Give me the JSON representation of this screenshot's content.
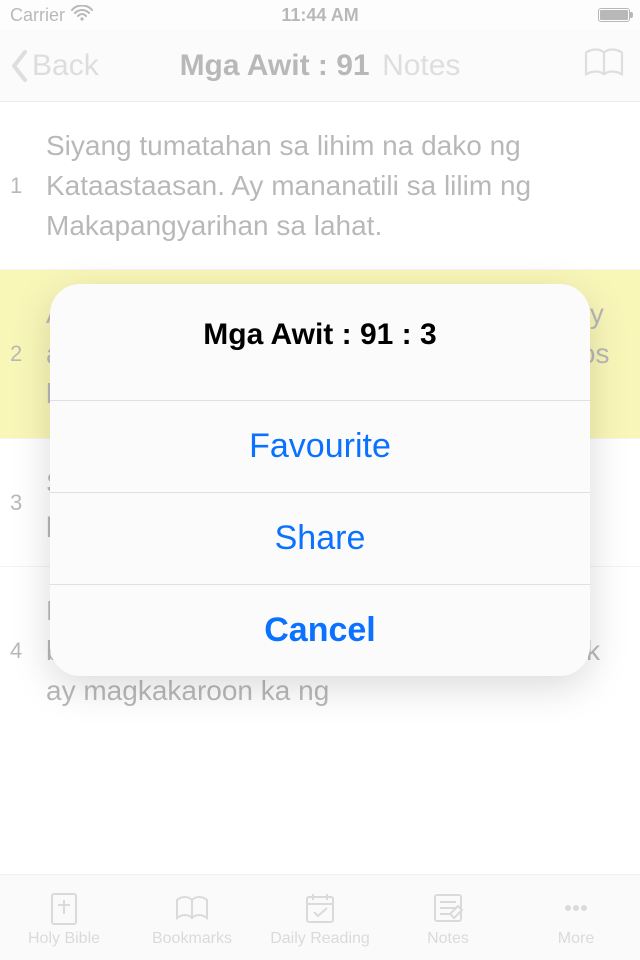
{
  "status": {
    "carrier": "Carrier",
    "time": "11:44 AM"
  },
  "nav": {
    "back": "Back",
    "title": "Mga Awit : 91",
    "subtitle": "Notes"
  },
  "verses": [
    {
      "n": "1",
      "text": "Siyang tumatahan sa lihim na dako ng Kataastaasan. Ay mananatili sa lilim ng Makapangyarihan sa lahat.",
      "hl": false
    },
    {
      "n": "2",
      "text": "Aking sasabihin tungkol sa Panginoon, siya'y aking kanlungan at aking katibayan, ang Dios ko na siyang aking tinitiwalaan.",
      "hl": true
    },
    {
      "n": "3",
      "text": "Sapagka't kaniyang ililigtas ka sa silo ng paninilo, at sa mapamuksang salot.",
      "hl": false
    },
    {
      "n": "4",
      "text": "Kaniyang tatakpan ka ng kaniyang mga bagwis, at sa ilalim ng kaniyang mga pakpak ay magkakaroon ka ng",
      "hl": false
    }
  ],
  "tabs": [
    {
      "label": "Holy Bible"
    },
    {
      "label": "Bookmarks"
    },
    {
      "label": "Daily Reading"
    },
    {
      "label": "Notes"
    },
    {
      "label": "More"
    }
  ],
  "sheet": {
    "title": "Mga Awit : 91 : 3",
    "favourite": "Favourite",
    "share": "Share",
    "cancel": "Cancel"
  }
}
